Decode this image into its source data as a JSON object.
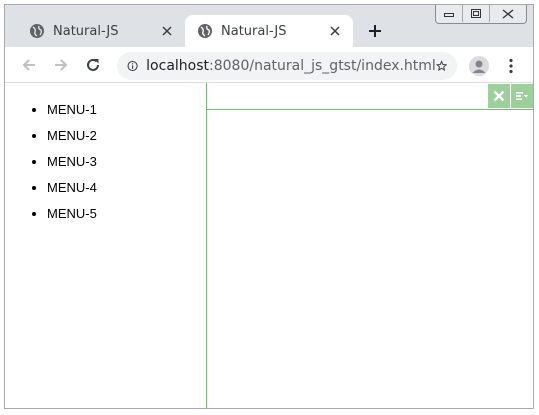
{
  "browser": {
    "tabs": [
      {
        "title": "Natural-JS",
        "active": false
      },
      {
        "title": "Natural-JS",
        "active": true
      }
    ],
    "address": {
      "host": "localhost",
      "rest": ":8080/natural_js_gtst/index.html"
    }
  },
  "sidebar": {
    "items": [
      {
        "label": "MENU-1"
      },
      {
        "label": "MENU-2"
      },
      {
        "label": "MENU-3"
      },
      {
        "label": "MENU-4"
      },
      {
        "label": "MENU-5"
      }
    ]
  },
  "colors": {
    "tabstrip": "#dee1e6",
    "panel_border": "#7bb57a",
    "header_button": "#9ccf9b"
  },
  "icons": {
    "tab_favicon": "globe-icon",
    "tab_close": "close-icon",
    "new_tab": "plus-icon",
    "back": "arrow-left-icon",
    "forward": "arrow-right-icon",
    "reload": "reload-icon",
    "site_info": "info-icon",
    "bookmark": "star-icon",
    "profile": "avatar-icon",
    "browser_menu": "kebab-menu-icon",
    "panel_close": "close-icon",
    "panel_more": "menu-icon"
  }
}
